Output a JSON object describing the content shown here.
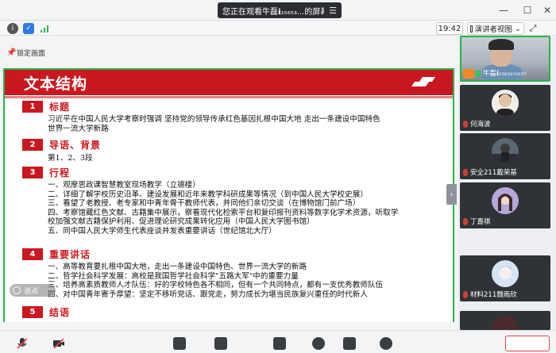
{
  "window": {
    "banner_text": "您正在观看牛磊ℹ₁₅₆₅₃...的屏幕",
    "banner_menu_icon": "menu-icon"
  },
  "toolbar": {
    "time": "19:42",
    "view_label": "演讲者视图",
    "view_caret": "⌄"
  },
  "lock": {
    "label": "锁定画面"
  },
  "slide": {
    "title": "文本结构",
    "sections": [
      {
        "num": "1",
        "label": "标题"
      },
      {
        "num": "2",
        "label": "导语、背景"
      },
      {
        "num": "3",
        "label": "行程"
      },
      {
        "num": "4",
        "label": "重要讲话"
      },
      {
        "num": "5",
        "label": "结语"
      }
    ],
    "s1_lines": [
      "习近平在中国人民大学考察时强调 坚持党的领导传承红色基因扎根中国大地 走出一条建设中国特色",
      "世界一流大学新路"
    ],
    "s2_lines": [
      "第1、2、3段"
    ],
    "s3_lines": [
      "一、观摩思政课智慧教室现场教学（立德楼）",
      "二、详细了解学校历史沿革、建设发展和近年来教学科研成果等情况（到中国人民大学校史展）",
      "三、看望了老教授、老专家和中青年骨干教师代表，并同他们亲切交谈（在博物馆门前广场）",
      "四、考察馆藏红色文献、古籍集中展示，察看现代化检索平台和复印报刊资料等数字化学术资源，听取学",
      "校加强文献古籍保护利用、促进理论研究成果转化应用（中国人民大学图书馆）",
      "五、同中国人民大学师生代表座谈并发表重要讲话（世纪馆北大厅）"
    ],
    "s4_lines": [
      "一、高等教育要扎根中国大地，走出一条建设中国特色、世界一流大学的新路",
      "二、哲学社会科学发展：高校是我国哲学社会科学\"五路大军\"中的重要力量",
      "三、培养高素质教师人才队伍：好的学校特色各不相同，但有一个共同特点，都有一支优秀教师队伍",
      "四、对中国青年寄予厚望：坚定不移听党话、跟党走，努力成长为堪当民族复兴重任的时代新人"
    ]
  },
  "bubble_label": "说点",
  "participants": [
    {
      "name": "牛磊ℹ₁₅₆₅₃₇₀₅₃₇",
      "mic": "on",
      "self": true
    },
    {
      "name": "何海波",
      "mic": "off"
    },
    {
      "name": "安全211戴荣基",
      "mic": "off"
    },
    {
      "name": "丁嘉祺",
      "mic": "off"
    },
    {
      "name": "材料211魏雨欣",
      "mic": "off"
    }
  ],
  "colors": {
    "accent_red": "#c91820",
    "share_border": "#2cb24a"
  }
}
